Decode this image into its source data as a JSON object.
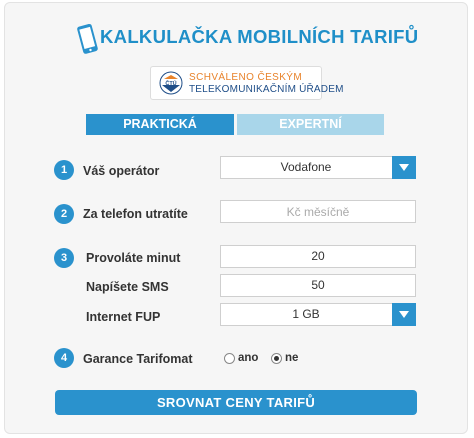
{
  "header": {
    "title": "KALKULAČKA MOBILNÍCH TARIFŮ",
    "icon": "phone-icon"
  },
  "badge": {
    "line1": "SCHVÁLENO ČESKÝM",
    "line2": "TELEKOMUNIKAČNÍM ÚŘADEM",
    "logo_text": "ČTÚ"
  },
  "tabs": [
    {
      "label": "PRAKTICKÁ",
      "active": true
    },
    {
      "label": "EXPERTNÍ",
      "active": false
    }
  ],
  "steps": {
    "s1": {
      "number": "1",
      "label": "Váš operátor",
      "value": "Vodafone"
    },
    "s2": {
      "number": "2",
      "label": "Za telefon utratíte",
      "placeholder": "Kč měsíčně"
    },
    "s3": {
      "number": "3",
      "minutes_label": "Provoláte minut",
      "minutes_value": "20",
      "sms_label": "Napíšete SMS",
      "sms_value": "50",
      "fup_label": "Internet FUP",
      "fup_value": "1 GB"
    },
    "s4": {
      "number": "4",
      "label": "Garance Tarifomat",
      "option_yes": "ano",
      "option_no": "ne",
      "selected": "ne"
    }
  },
  "submit_label": "SROVNAT CENY TARIFŮ",
  "colors": {
    "accent": "#2a92cd",
    "tab_inactive": "#a9d6ea",
    "title": "#1f8fc8",
    "badge_orange": "#e8832b",
    "badge_blue": "#1f4e88"
  }
}
